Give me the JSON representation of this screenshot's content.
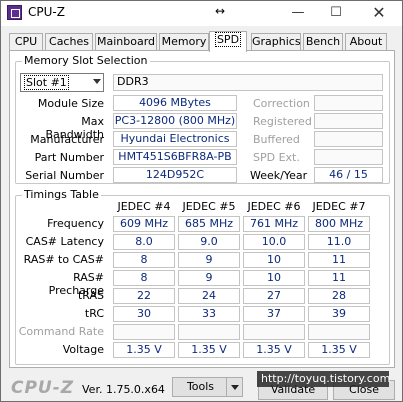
{
  "window": {
    "title": "CPU-Z",
    "resize_glyph": "↔",
    "min_glyph": "—",
    "max_glyph": "☐",
    "close_glyph": "✕"
  },
  "tabs": [
    {
      "label": "CPU"
    },
    {
      "label": "Caches"
    },
    {
      "label": "Mainboard"
    },
    {
      "label": "Memory"
    },
    {
      "label": "SPD"
    },
    {
      "label": "Graphics"
    },
    {
      "label": "Bench"
    },
    {
      "label": "About"
    }
  ],
  "memory_slot": {
    "group_title": "Memory Slot Selection",
    "slot_value": "Slot #1",
    "type": "DDR3",
    "module_size_label": "Module Size",
    "module_size": "4096 MBytes",
    "max_bandwidth_label": "Max Bandwidth",
    "max_bandwidth": "PC3-12800 (800 MHz)",
    "manufacturer_label": "Manufacturer",
    "manufacturer": "Hyundai Electronics",
    "part_number_label": "Part Number",
    "part_number": "HMT451S6BFR8A-PB",
    "serial_number_label": "Serial Number",
    "serial_number": "124D952C",
    "correction_label": "Correction",
    "registered_label": "Registered",
    "buffered_label": "Buffered",
    "spd_ext_label": "SPD Ext.",
    "week_year_label": "Week/Year",
    "week_year": "46 / 15"
  },
  "timings": {
    "group_title": "Timings Table",
    "columns": [
      "JEDEC #4",
      "JEDEC #5",
      "JEDEC #6",
      "JEDEC #7"
    ],
    "rows": [
      {
        "label": "Frequency",
        "values": [
          "609 MHz",
          "685 MHz",
          "761 MHz",
          "800 MHz"
        ],
        "dim": false
      },
      {
        "label": "CAS# Latency",
        "values": [
          "8.0",
          "9.0",
          "10.0",
          "11.0"
        ],
        "dim": false
      },
      {
        "label": "RAS# to CAS#",
        "values": [
          "8",
          "9",
          "10",
          "11"
        ],
        "dim": false
      },
      {
        "label": "RAS# Precharge",
        "values": [
          "8",
          "9",
          "10",
          "11"
        ],
        "dim": false
      },
      {
        "label": "tRAS",
        "values": [
          "22",
          "24",
          "27",
          "28"
        ],
        "dim": false
      },
      {
        "label": "tRC",
        "values": [
          "30",
          "33",
          "37",
          "39"
        ],
        "dim": false
      },
      {
        "label": "Command Rate",
        "values": [
          "",
          "",
          "",
          ""
        ],
        "dim": true
      },
      {
        "label": "Voltage",
        "values": [
          "1.35 V",
          "1.35 V",
          "1.35 V",
          "1.35 V"
        ],
        "dim": false
      }
    ]
  },
  "footer": {
    "logo": "CPU-Z",
    "version": "Ver. 1.75.0.x64",
    "tools_label": "Tools",
    "validate_label": "Validate",
    "close_label": "Close",
    "watermark": "http://toyuq.tistory.com"
  }
}
